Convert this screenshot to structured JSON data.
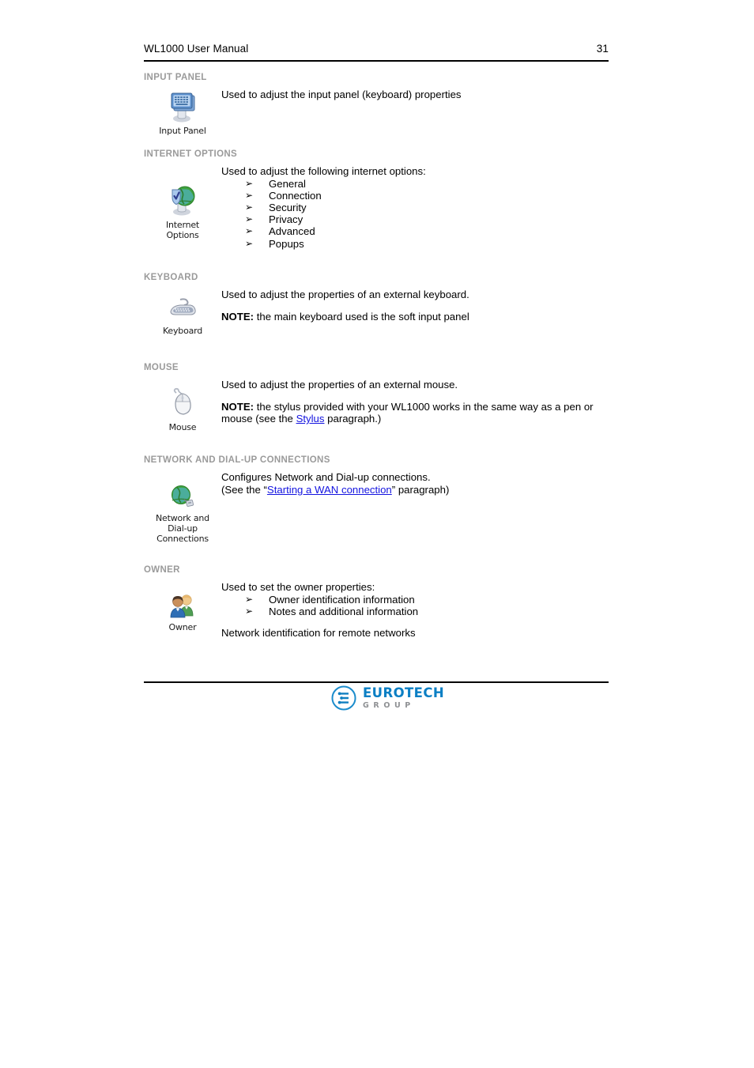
{
  "header": {
    "document_title": "WL1000 User Manual",
    "page_number": "31"
  },
  "sections": [
    {
      "id": "input-panel",
      "title": "INPUT PANEL",
      "icon_name": "input-panel-icon",
      "icon_caption": "Input Panel",
      "lines": [
        {
          "type": "paragraph",
          "text": "Used to adjust the input panel (keyboard) properties"
        }
      ]
    },
    {
      "id": "internet-options",
      "title": "INTERNET OPTIONS",
      "icon_name": "internet-options-icon",
      "icon_caption": "Internet\nOptions",
      "icon_caption_line1": "Internet",
      "icon_caption_line2": "Options",
      "lines": [
        {
          "type": "paragraph",
          "text": "Used to adjust the following internet options:"
        }
      ],
      "bullets": [
        "General",
        "Connection",
        "Security",
        "Privacy",
        "Advanced",
        "Popups"
      ],
      "bullet_glyph": "➢"
    },
    {
      "id": "keyboard",
      "title": "KEYBOARD",
      "icon_name": "keyboard-icon",
      "icon_caption": "Keyboard",
      "lines": [
        {
          "type": "paragraph",
          "text": "Used to adjust the properties of an external keyboard."
        },
        {
          "type": "note",
          "label": "NOTE:",
          "text": " the main keyboard used is the soft input panel"
        }
      ]
    },
    {
      "id": "mouse",
      "title": "MOUSE",
      "icon_name": "mouse-icon",
      "icon_caption": "Mouse",
      "lines": [
        {
          "type": "paragraph",
          "text": "Used to adjust the properties of an external mouse."
        },
        {
          "type": "note-with-link",
          "label": "NOTE:",
          "text_before": " the stylus provided with your WL1000 works in the same way as a pen or mouse (see the ",
          "link_text": "Stylus",
          "text_after": " paragraph.)"
        }
      ]
    },
    {
      "id": "network-dialup",
      "title": "NETWORK AND DIAL-UP CONNECTIONS",
      "icon_name": "network-dialup-icon",
      "icon_caption_line1": "Network and",
      "icon_caption_line2": "Dial-up",
      "icon_caption_line3": "Connections",
      "lines": [
        {
          "type": "paragraph",
          "text": "Configures Network and Dial-up connections."
        },
        {
          "type": "link-line",
          "text_before": "(See the “",
          "link_text": "Starting a WAN connection",
          "text_after": "” paragraph)"
        }
      ]
    },
    {
      "id": "owner",
      "title": "OWNER",
      "icon_name": "owner-icon",
      "icon_caption": "Owner",
      "lines": [
        {
          "type": "paragraph",
          "text": "Used to set the owner properties:"
        }
      ],
      "bullets": [
        "Owner identification information",
        "Notes and additional information"
      ],
      "bullet_glyph": "➢",
      "trailing_paragraph": "Network identification for remote networks"
    }
  ],
  "footer": {
    "logo_name": "EUROTECH",
    "logo_sub": "GROUP",
    "brand_color": "#0b7fc4",
    "sub_color": "#8f9194"
  }
}
